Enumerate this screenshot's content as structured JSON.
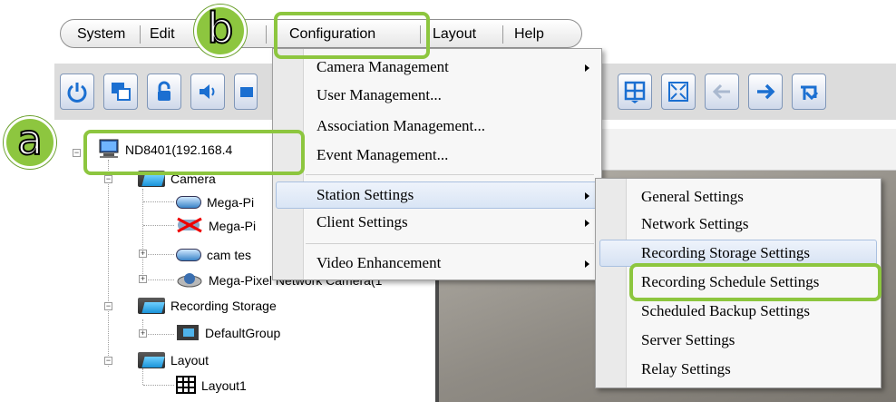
{
  "menubar": {
    "items": [
      "System",
      "Edit",
      "Configuration",
      "Layout",
      "Help"
    ]
  },
  "callouts": {
    "a": "a",
    "b": "b"
  },
  "configuration_menu": {
    "items": [
      {
        "label": "Camera Management",
        "submenu": true
      },
      {
        "label": "User Management...",
        "submenu": false
      },
      {
        "label": "Association Management...",
        "submenu": false
      },
      {
        "label": "Event Management...",
        "submenu": false
      },
      {
        "label": "Station Settings",
        "submenu": true,
        "highlighted": true
      },
      {
        "label": "Client Settings",
        "submenu": true
      },
      {
        "label": "Video Enhancement",
        "submenu": true
      }
    ]
  },
  "station_settings_submenu": {
    "items": [
      "General Settings",
      "Network Settings",
      "Recording Storage Settings",
      "Recording Schedule Settings",
      "Scheduled Backup Settings",
      "Server Settings",
      "Relay Settings"
    ],
    "highlighted": "Recording Storage Settings",
    "callout": "Recording Schedule Settings"
  },
  "toolbar": {
    "icons": [
      "power-icon",
      "display-swap-icon",
      "lock-icon",
      "speaker-icon",
      "record-icon",
      "grid-layout-icon",
      "fullscreen-icon",
      "back-arrow-icon",
      "forward-arrow-icon",
      "return-icon"
    ]
  },
  "tree": {
    "root": "ND8401(192.168.4",
    "camera_folder": "Camera",
    "cameras": [
      "Mega-Pi",
      "Mega-Pi",
      "cam tes",
      "Mega-Pixel Network Camera(1"
    ],
    "recording_storage": "Recording Storage",
    "default_group": "DefaultGroup",
    "layout_folder": "Layout",
    "layout1": "Layout1"
  },
  "colors": {
    "callout_green": "#8dc63f",
    "menu_highlight": "#d9e5f5",
    "toolbar_icon_blue": "#1b6fd1"
  }
}
